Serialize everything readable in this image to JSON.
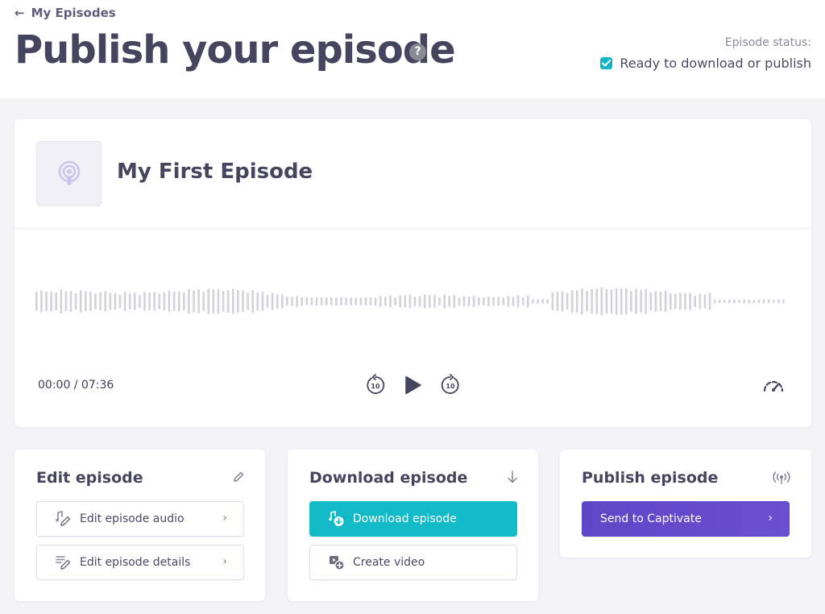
{
  "header": {
    "back_label": "My Episodes",
    "title": "Publish your episode",
    "help_icon": "question-circle-icon",
    "status_label": "Episode status:",
    "status_text": "Ready to download or publish",
    "status_checked": true
  },
  "player": {
    "episode_title": "My First Episode",
    "time": "00:00 / 07:36",
    "skip_seconds": "10"
  },
  "edit": {
    "title": "Edit episode",
    "audio_label": "Edit episode audio",
    "details_label": "Edit episode details"
  },
  "download": {
    "title": "Download episode",
    "download_label": "Download episode",
    "video_label": "Create video"
  },
  "publish": {
    "title": "Publish episode",
    "send_label": "Send to Captivate"
  },
  "colors": {
    "accent_teal": "#12b9c6",
    "accent_purple": "#5f46c7",
    "text_dark": "#45455f",
    "waveform": "#d2d2dc"
  }
}
